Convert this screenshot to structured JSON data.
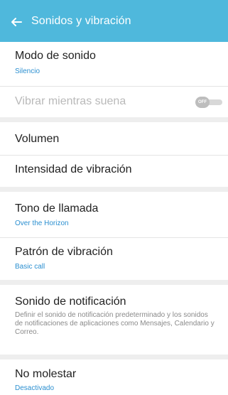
{
  "app_bar": {
    "title": "Sonidos y vibración",
    "back_icon": "arrow-left-icon",
    "color": "#4fb8dc"
  },
  "settings": {
    "sound_mode": {
      "title": "Modo de sonido",
      "value": "Silencio"
    },
    "vibrate_while_ringing": {
      "title": "Vibrar mientras suena",
      "toggle_label": "OFF",
      "enabled": false
    },
    "volume": {
      "title": "Volumen"
    },
    "vibration_intensity": {
      "title": "Intensidad de vibración"
    },
    "ringtone": {
      "title": "Tono de llamada",
      "value": "Over the Horizon"
    },
    "vibration_pattern": {
      "title": "Patrón de vibración",
      "value": "Basic call"
    },
    "notification_sound": {
      "title": "Sonido de notificación",
      "description": "Definir el sonido de notificación predeterminado y los sonidos de notificaciones de aplicaciones como Mensajes, Calendario y Correo."
    },
    "do_not_disturb": {
      "title": "No molestar",
      "value": "Desactivado"
    }
  },
  "colors": {
    "subtitle": "#2b8fd0",
    "divider": "#eeeeee"
  }
}
